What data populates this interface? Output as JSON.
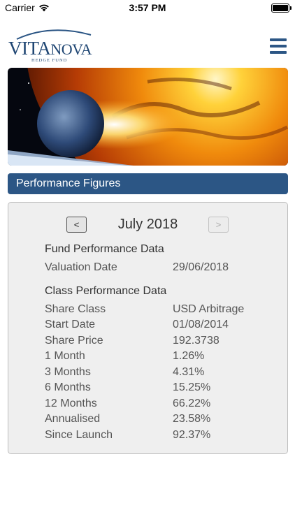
{
  "status_bar": {
    "carrier": "Carrier",
    "time": "3:57 PM"
  },
  "logo": {
    "vita": "VITA",
    "nova": "NOVA",
    "tagline": "HEDGE FUND"
  },
  "header": {
    "menu_icon": "hamburger-menu-icon"
  },
  "banner": {
    "image": "planet-and-sun"
  },
  "section": {
    "title": "Performance Figures"
  },
  "period": {
    "prev_label": "<",
    "next_label": ">",
    "month": "July 2018"
  },
  "fund_performance": {
    "title": "Fund Performance Data",
    "rows": [
      {
        "label": "Valuation Date",
        "value": "29/06/2018"
      }
    ]
  },
  "class_performance": {
    "title": "Class Performance Data",
    "rows": [
      {
        "label": "Share Class",
        "value": "USD Arbitrage"
      },
      {
        "label": "Start Date",
        "value": "01/08/2014"
      },
      {
        "label": "Share Price",
        "value": "192.3738"
      },
      {
        "label": "1 Month",
        "value": "1.26%"
      },
      {
        "label": "3 Months",
        "value": "4.31%"
      },
      {
        "label": "6 Months",
        "value": "15.25%"
      },
      {
        "label": "12 Months",
        "value": "66.22%"
      },
      {
        "label": "Annualised",
        "value": "23.58%"
      },
      {
        "label": "Since Launch",
        "value": "92.37%"
      }
    ]
  },
  "colors": {
    "brand_blue": "#2c5685",
    "logo_blue": "#1f4673",
    "panel_bg": "#efefef"
  }
}
